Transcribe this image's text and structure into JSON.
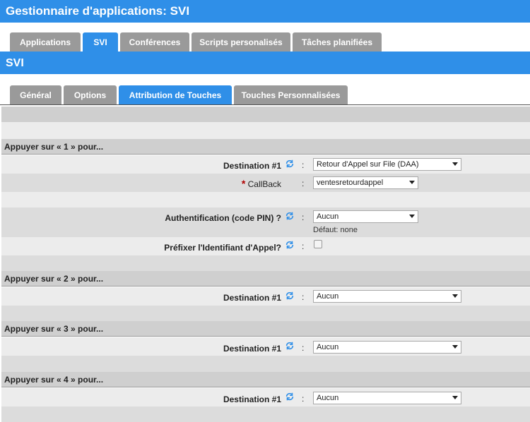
{
  "app_title": "Gestionnaire d'applications:  SVI",
  "main_tabs": [
    {
      "label": "Applications",
      "active": false
    },
    {
      "label": "SVI",
      "active": true
    },
    {
      "label": "Conférences",
      "active": false
    },
    {
      "label": "Scripts personalisés",
      "active": false
    },
    {
      "label": "Tâches planifiées",
      "active": false
    }
  ],
  "section_title": "SVI",
  "sub_tabs": [
    {
      "label": "Général",
      "active": false
    },
    {
      "label": "Options",
      "active": false
    },
    {
      "label": "Attribution de Touches",
      "active": true
    },
    {
      "label": "Touches Personnalisées",
      "active": false
    }
  ],
  "colon": ":",
  "key1": {
    "header": "Appuyer sur « 1 » pour...",
    "destination_label": "Destination #1",
    "destination_value": "Retour d'Appel sur File (DAA)",
    "callback_required": "*",
    "callback_label": "CallBack",
    "callback_value": "ventesretourdappel",
    "auth_label": "Authentification (code PIN) ?",
    "auth_value": "Aucun",
    "auth_default": "Défaut: none",
    "prefix_label": "Préfixer l'Identifiant d'Appel?",
    "prefix_checked": false
  },
  "key2": {
    "header": "Appuyer sur « 2 » pour...",
    "destination_label": "Destination #1",
    "destination_value": "Aucun"
  },
  "key3": {
    "header": "Appuyer sur « 3 » pour...",
    "destination_label": "Destination #1",
    "destination_value": "Aucun"
  },
  "key4": {
    "header": "Appuyer sur « 4 » pour...",
    "destination_label": "Destination #1",
    "destination_value": "Aucun"
  },
  "icons": {
    "refresh": "refresh-icon",
    "dropdown": "chevron-down-icon"
  },
  "colors": {
    "primary": "#2f8fe8",
    "tab_inactive": "#9a9a9a",
    "required": "#b00000"
  }
}
